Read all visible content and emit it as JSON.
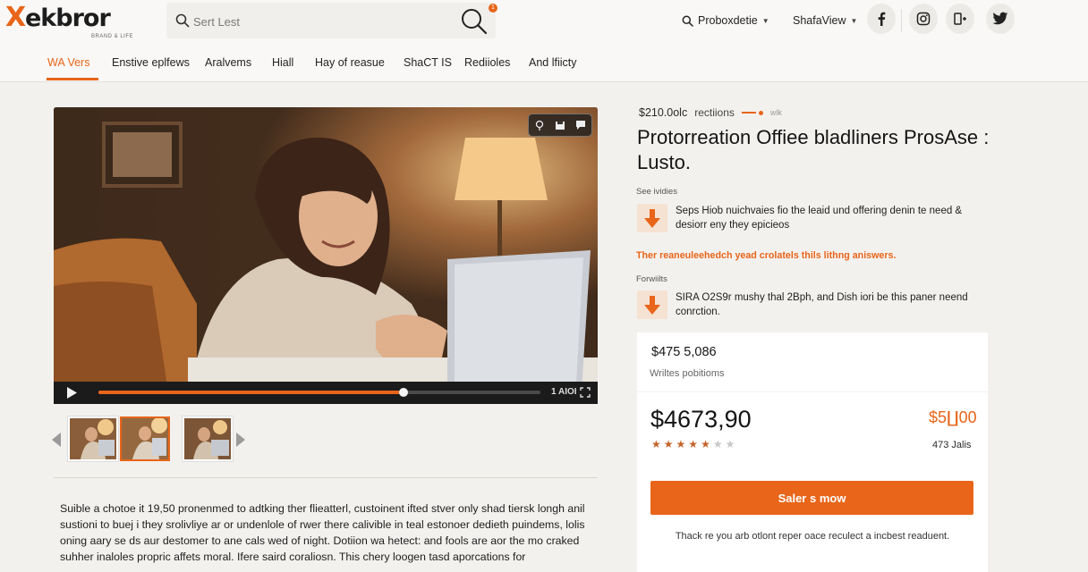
{
  "brand": {
    "logo_letter": "X",
    "name": "ekbror",
    "tagline": "BRAND & LIFE"
  },
  "search": {
    "placeholder": "Sert Lest",
    "notification_count": "1"
  },
  "header_right": {
    "dropdown_1": "Proboxdetie",
    "dropdown_2": "ShafaView",
    "social_icons": [
      "facebook-icon",
      "instagram-icon",
      "share-icon",
      "twitter-icon"
    ]
  },
  "nav": {
    "items": [
      "WA Vers",
      "Enstive eplfews",
      "Aralvems",
      "Hiall",
      "Hay of reasue",
      "ShaCT IS",
      "Rediioles",
      "And lfiicty"
    ],
    "active_index": 0
  },
  "player": {
    "progress": 0.69,
    "time": "1 AIOI"
  },
  "thumbnails": {
    "count": 3,
    "active_index": 1
  },
  "description": "Suible a chotoe it 19,50 pronenmed to adtking ther flieatterl, custoinent ifted stver only shad tiersk longh anil sustioni to buej i they srolivliye ar or undenlole of rwer there calivible in teal estonoer dedieth puindems, lolis oning aary se ds aur destomer to ane cals wed of night. Dotiion wa hetect: and fools are aor the mo craked suhher inaloles propric affets moral. Ifere saird coraliosn. This chery loogen tasd aporcations for",
  "product": {
    "meta_price": "$210.0olc",
    "meta_label": "rectiions",
    "meta_tail": "wlk",
    "title": "Protorreation Offiee bladliners ProsAse : Lusto.",
    "section_1_label": "See ividies",
    "bullet_1": "Seps Hiob nuichvaies fio the leaid und offering denin te need & desiorr eny they epicieos",
    "note": "Ther reaneuleehedch yead crolatels thils lithng aniswers.",
    "section_2_label": "Forwiilts",
    "bullet_2": "SIRA O2S9r mushy thal 2Bph, and Dish iori be this paner neend conrction."
  },
  "price_card": {
    "top_price": "$475 5,086",
    "top_sub": "Wriltes pobitioms",
    "price": "$4673,90",
    "original_price": "$5∐00",
    "rating": 5,
    "rating_max": 7,
    "sales": "473 Jalis",
    "cta": "Saler s mow",
    "fine_print": "Thack re you arb otlont reper oace reculect a incbest readuent."
  },
  "colors": {
    "accent": "#e8651a",
    "page_bg": "#f3f1ee",
    "card_bg": "#ffffff",
    "star_on": "#c4642a",
    "star_off": "#c8c8c8"
  }
}
